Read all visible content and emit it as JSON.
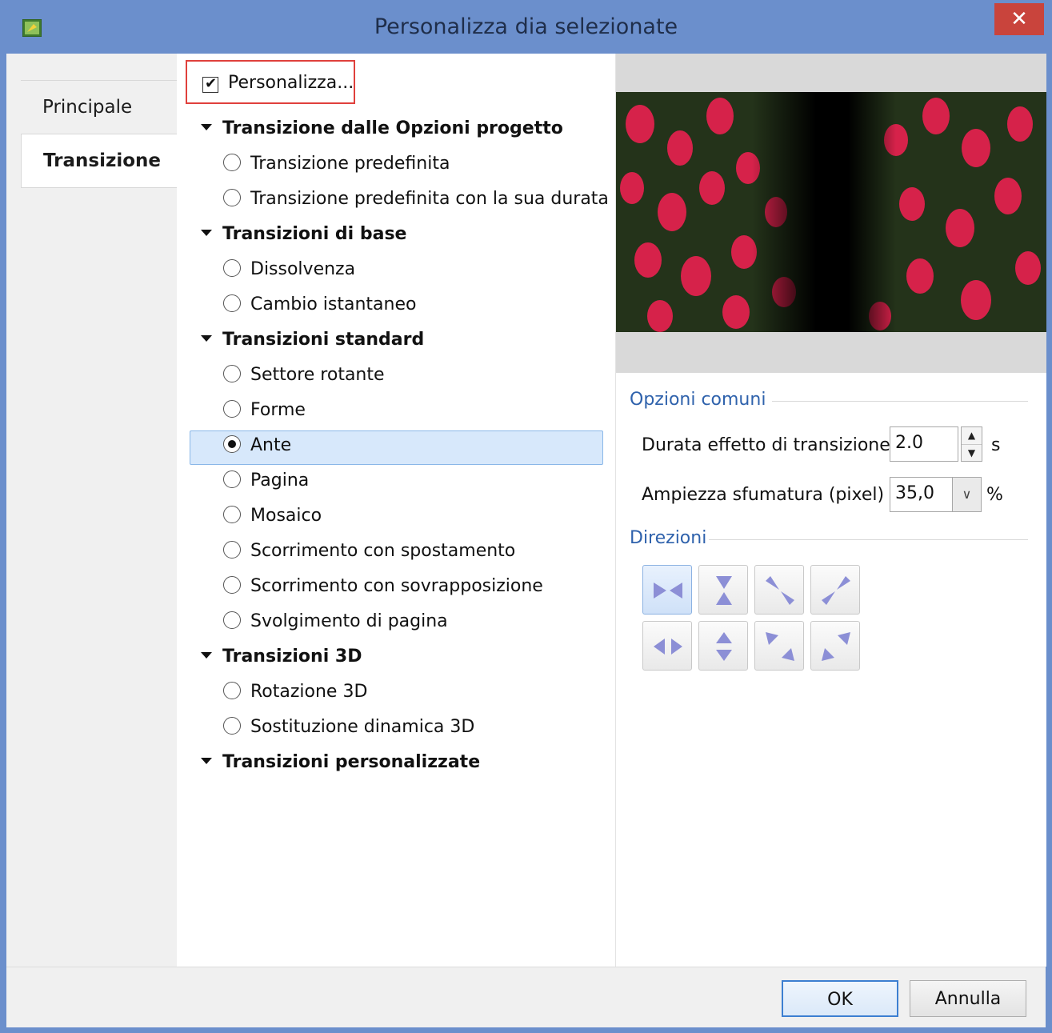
{
  "window": {
    "title": "Personalizza dia selezionate",
    "close_glyph": "✕"
  },
  "tabs": [
    {
      "label": "Principale"
    },
    {
      "label": "Transizione"
    }
  ],
  "customize": {
    "label": "Personalizza...",
    "checked": true
  },
  "groups": [
    {
      "label": "Transizione dalle Opzioni progetto",
      "items": [
        "Transizione predefinita",
        "Transizione predefinita con la sua durata"
      ]
    },
    {
      "label": "Transizioni di base",
      "items": [
        "Dissolvenza",
        "Cambio istantaneo"
      ]
    },
    {
      "label": "Transizioni standard",
      "items": [
        "Settore rotante",
        "Forme",
        "Ante",
        "Pagina",
        "Mosaico",
        "Scorrimento con spostamento",
        "Scorrimento con sovrapposizione",
        "Svolgimento di pagina"
      ]
    },
    {
      "label": "Transizioni 3D",
      "items": [
        "Rotazione 3D",
        "Sostituzione dinamica 3D"
      ]
    },
    {
      "label": "Transizioni personalizzate",
      "items": []
    }
  ],
  "selected_item": "Ante",
  "options": {
    "section_title": "Opzioni comuni",
    "duration_label": "Durata effetto di transizione",
    "duration_value": "2.0",
    "duration_unit": "s",
    "feather_label": "Ampiezza sfumatura (pixel)",
    "feather_value": "35,0",
    "feather_unit": "%"
  },
  "directions": {
    "section_title": "Direzioni",
    "buttons": [
      "arrows-converge-horizontal-icon",
      "arrows-converge-vertical-icon",
      "arrows-converge-diagonal-icon",
      "arrows-converge-antidiagonal-icon",
      "arrows-diverge-horizontal-icon",
      "arrows-diverge-vertical-icon",
      "arrows-diverge-diagonal-icon",
      "arrows-diverge-antidiagonal-icon"
    ],
    "active_index": 0
  },
  "footer": {
    "ok_label": "OK",
    "cancel_label": "Annulla"
  },
  "colors": {
    "titlebar": "#6b8fcc",
    "close": "#c9443c",
    "accent": "#2f62ac",
    "selection": "#d7e8fb"
  }
}
